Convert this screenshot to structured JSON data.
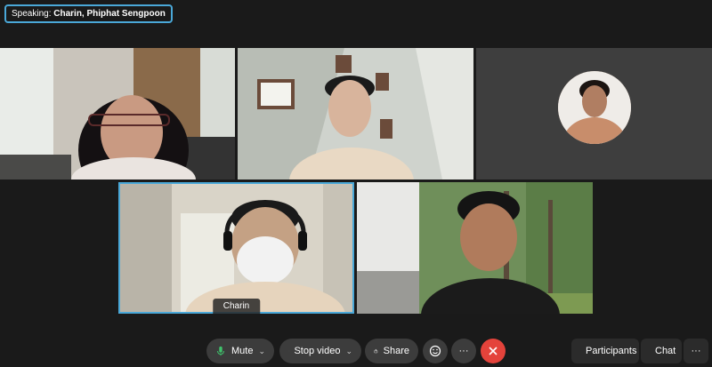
{
  "speaking": {
    "prefix": "Speaking:",
    "names": "Charin, Phiphat Sengpoon"
  },
  "participants": [
    {
      "tile": "tile-1"
    },
    {
      "tile": "tile-2"
    },
    {
      "tile": "tile-3-avatar"
    },
    {
      "tile": "tile-4",
      "name_label": "Charin",
      "active": true
    },
    {
      "tile": "tile-5"
    }
  ],
  "toolbar": {
    "mute_label": "Mute",
    "stop_video_label": "Stop video",
    "share_label": "Share",
    "more_label": "···",
    "participants_label": "Participants",
    "chat_label": "Chat",
    "overflow_label": "···"
  },
  "colors": {
    "accent": "#4aa8d8",
    "end_call": "#e4433b",
    "button_bg": "#3c3c3c",
    "mic_green": "#3fc16b"
  }
}
